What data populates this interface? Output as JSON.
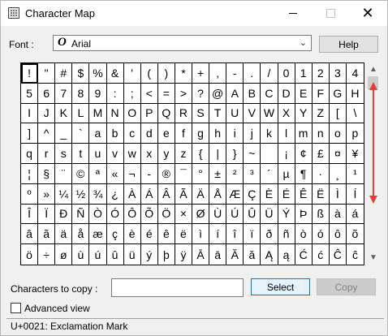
{
  "window": {
    "title": "Character Map"
  },
  "title_buttons": {
    "minimize": "—",
    "maximize": "☐",
    "close": "✕"
  },
  "font": {
    "label": "Font :",
    "value": "Arial",
    "icon_glyph": "O"
  },
  "help_label": "Help",
  "characters": [
    "!",
    "\"",
    "#",
    "$",
    "%",
    "&",
    "'",
    "(",
    ")",
    "*",
    "+",
    ",",
    "-",
    ".",
    "/",
    "0",
    "1",
    "2",
    "3",
    "4",
    "5",
    "6",
    "7",
    "8",
    "9",
    ":",
    ";",
    "<",
    "=",
    ">",
    "?",
    "@",
    "A",
    "B",
    "C",
    "D",
    "E",
    "F",
    "G",
    "H",
    "I",
    "J",
    "K",
    "L",
    "M",
    "N",
    "O",
    "P",
    "Q",
    "R",
    "S",
    "T",
    "U",
    "V",
    "W",
    "X",
    "Y",
    "Z",
    "[",
    "\\",
    "]",
    "^",
    "_",
    "`",
    "a",
    "b",
    "c",
    "d",
    "e",
    "f",
    "g",
    "h",
    "i",
    "j",
    "k",
    "l",
    "m",
    "n",
    "o",
    "p",
    "q",
    "r",
    "s",
    "t",
    "u",
    "v",
    "w",
    "x",
    "y",
    "z",
    "{",
    "|",
    "}",
    "~",
    "",
    "¡",
    "¢",
    "£",
    "¤",
    "¥",
    "¦",
    "§",
    "¨",
    "©",
    "ª",
    "«",
    "¬",
    "-",
    "®",
    "¯",
    "°",
    "±",
    "²",
    "³",
    "´",
    "µ",
    "¶",
    "·",
    "¸",
    "¹",
    "º",
    "»",
    "¼",
    "½",
    "¾",
    "¿",
    "À",
    "Á",
    "Â",
    "Ã",
    "Ä",
    "Å",
    "Æ",
    "Ç",
    "È",
    "É",
    "Ê",
    "Ë",
    "Ì",
    "Í",
    "Î",
    "Ï",
    "Ð",
    "Ñ",
    "Ò",
    "Ó",
    "Ô",
    "Õ",
    "Ö",
    "×",
    "Ø",
    "Ù",
    "Ú",
    "Û",
    "Ü",
    "Ý",
    "Þ",
    "ß",
    "à",
    "á",
    "â",
    "ã",
    "ä",
    "å",
    "æ",
    "ç",
    "è",
    "é",
    "ê",
    "ë",
    "ì",
    "í",
    "î",
    "ï",
    "ð",
    "ñ",
    "ò",
    "ó",
    "ô",
    "õ",
    "ö",
    "÷",
    "ø",
    "ù",
    "ú",
    "û",
    "ü",
    "ý",
    "þ",
    "ÿ",
    "Ā",
    "ā",
    "Ă",
    "ă",
    "Ą",
    "ą",
    "Ć",
    "ć",
    "Ĉ",
    "ĉ"
  ],
  "selected_index": 0,
  "copy": {
    "label": "Characters to copy :",
    "value": ""
  },
  "select_label": "Select",
  "copy_label": "Copy",
  "advanced_view": {
    "label": "Advanced view",
    "checked": false
  },
  "status": "U+0021: Exclamation Mark",
  "scroll_arrows": {
    "up": "▲",
    "down": "▼"
  },
  "colors": {
    "annotation_arrow": "#e0403a",
    "select_border": "#0078d7"
  },
  "icons": {
    "app": "character-map-icon",
    "dropdown": "chevron-down-icon"
  }
}
